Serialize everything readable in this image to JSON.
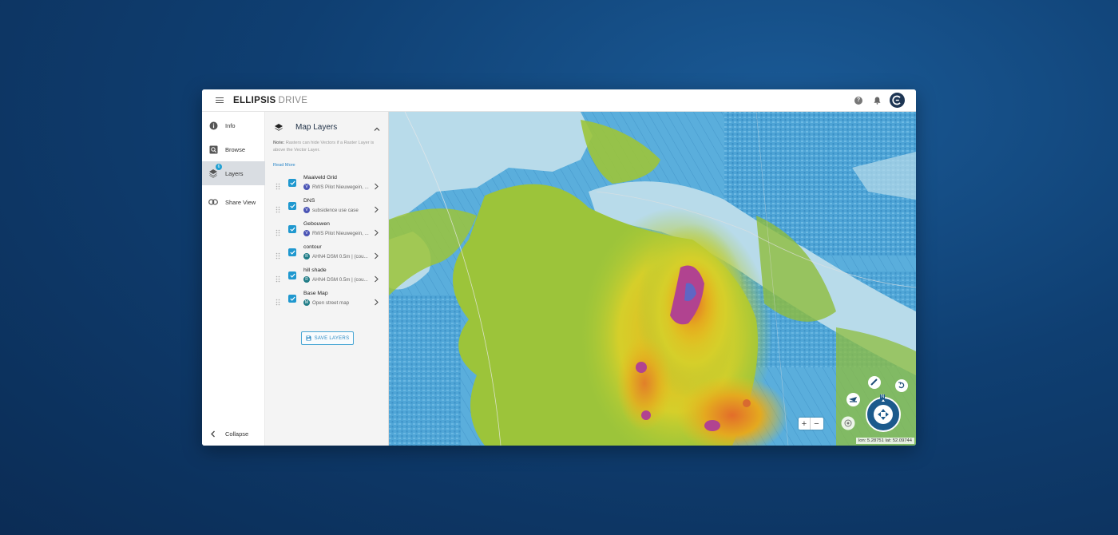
{
  "app": {
    "brand": "ELLIPSIS",
    "product": "DRIVE"
  },
  "topbar": {
    "help_icon": "help-icon",
    "bell_icon": "bell-icon",
    "avatar_icon": "ellipsis-avatar-icon"
  },
  "sidebar": {
    "items": [
      {
        "label": "Info",
        "icon": "info-icon"
      },
      {
        "label": "Browse",
        "icon": "browse-icon"
      },
      {
        "label": "Layers",
        "icon": "layers-icon",
        "badge": "6",
        "active": true
      },
      {
        "label": "Share View",
        "icon": "link-icon"
      }
    ],
    "collapse_label": "Collapse"
  },
  "panel": {
    "title": "Map Layers",
    "note_bold": "Note:",
    "note_text": "Rasters can hide Vectors if a Raster Layer is above the Vector Layer.",
    "read_more": "Read More",
    "layers": [
      {
        "name": "Maaiveld Grid",
        "source": "RWS Pilot Nieuwegein, ...",
        "type": "vector",
        "checked": true
      },
      {
        "name": "DNS",
        "source": "subsidence use case",
        "type": "vector",
        "checked": true
      },
      {
        "name": "Gebouwen",
        "source": "RWS Pilot Nieuwegein, ...",
        "type": "vector",
        "checked": true
      },
      {
        "name": "contour",
        "source": "AHN4 DSM 0.5m | (cou...",
        "type": "raster",
        "checked": true
      },
      {
        "name": "hill shade",
        "source": "AHN4 DSM 0.5m | (cou...",
        "type": "raster",
        "checked": true
      },
      {
        "name": "Base Map",
        "source": "Open street map",
        "type": "basemap",
        "checked": true
      }
    ],
    "save_label": "SAVE LAYERS"
  },
  "map": {
    "coords": "lon: 5.28751 lat: 52.09744",
    "zoom_in": "+",
    "zoom_out": "−",
    "compass_north": "N",
    "colors": {
      "water": "#b9dbe9",
      "low": "#4aa3d8",
      "mid": "#9bc63a",
      "high": "#e3c21e",
      "higher": "#e27a2a",
      "peak": "#b83d8a"
    }
  }
}
